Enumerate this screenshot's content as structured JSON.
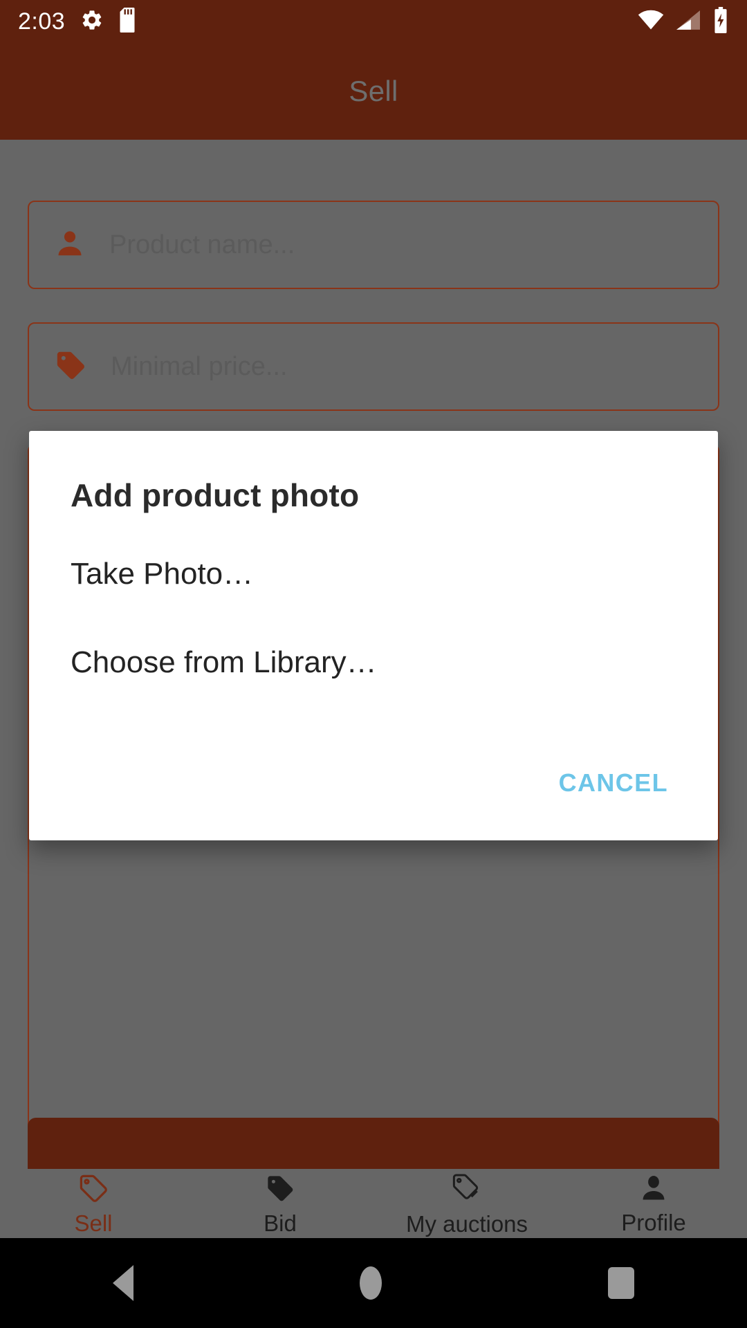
{
  "status_bar": {
    "clock": "2:03",
    "left_icons": [
      "settings-gear-icon",
      "sd-card-icon"
    ],
    "right_icons": [
      "wifi-icon",
      "cellular-signal-icon",
      "battery-charging-icon"
    ],
    "background_color": "#5f210e",
    "foreground_color": "#ffffff"
  },
  "app_bar": {
    "title": "Sell",
    "background_color": "#5f210e",
    "title_color": "#6e6e6e"
  },
  "form": {
    "scrim_color": "#666666",
    "field_border_color": "#8a3418",
    "fields": [
      {
        "icon": "person-icon",
        "placeholder": "Product name..."
      },
      {
        "icon": "price-tag-icon",
        "placeholder": "Minimal price..."
      },
      {
        "icon": "description-icon",
        "placeholder": ""
      }
    ],
    "submit_button": {
      "label": "",
      "color": "#5f210e"
    }
  },
  "dialog": {
    "title": "Add product photo",
    "options": [
      {
        "label": "Take Photo…"
      },
      {
        "label": "Choose from Library…"
      }
    ],
    "cancel_label": "CANCEL",
    "cancel_color": "#6dc5e8",
    "background_color": "#ffffff"
  },
  "bottom_nav": {
    "active_color": "#7a2e16",
    "inactive_color": "#1d1d1d",
    "items": [
      {
        "label": "Sell",
        "icon": "tag-outline-icon",
        "active": true
      },
      {
        "label": "Bid",
        "icon": "tag-filled-icon",
        "active": false
      },
      {
        "label": "My auctions",
        "icon": "double-tag-outline-icon",
        "active": false
      },
      {
        "label": "Profile",
        "icon": "person-filled-icon",
        "active": false
      }
    ]
  },
  "android_nav": {
    "back": "back-triangle-icon",
    "home": "home-circle-icon",
    "recents": "recents-square-icon",
    "icon_color": "#9a9a9a"
  }
}
